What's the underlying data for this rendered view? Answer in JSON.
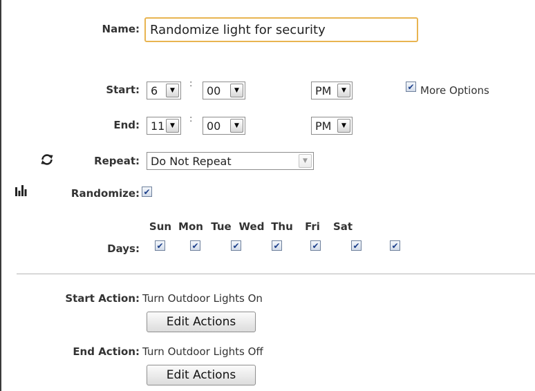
{
  "name": {
    "label": "Name:",
    "value": "Randomize light for security"
  },
  "start": {
    "label": "Start:",
    "hour": "6",
    "minute": "00",
    "ampm": "PM",
    "separator": ":"
  },
  "end": {
    "label": "End:",
    "hour": "11",
    "minute": "00",
    "ampm": "PM",
    "separator": ":"
  },
  "more_options": {
    "label": "More Options",
    "checked": true
  },
  "repeat": {
    "label": "Repeat:",
    "value": "Do Not Repeat",
    "icon": "refresh-icon"
  },
  "randomize": {
    "label": "Randomize:",
    "checked": true,
    "icon": "bars-icon"
  },
  "days": {
    "label": "Days:",
    "items": [
      {
        "name": "Sun",
        "checked": true
      },
      {
        "name": "Mon",
        "checked": true
      },
      {
        "name": "Tue",
        "checked": true
      },
      {
        "name": "Wed",
        "checked": true
      },
      {
        "name": "Thu",
        "checked": true
      },
      {
        "name": "Fri",
        "checked": true
      },
      {
        "name": "Sat",
        "checked": true
      }
    ]
  },
  "start_action": {
    "label": "Start Action:",
    "value": "Turn Outdoor Lights On",
    "button": "Edit Actions"
  },
  "end_action": {
    "label": "End Action:",
    "value": "Turn Outdoor Lights Off",
    "button": "Edit Actions"
  },
  "colors": {
    "focus_border": "#e8b450",
    "check_color": "#1c3f8a"
  }
}
